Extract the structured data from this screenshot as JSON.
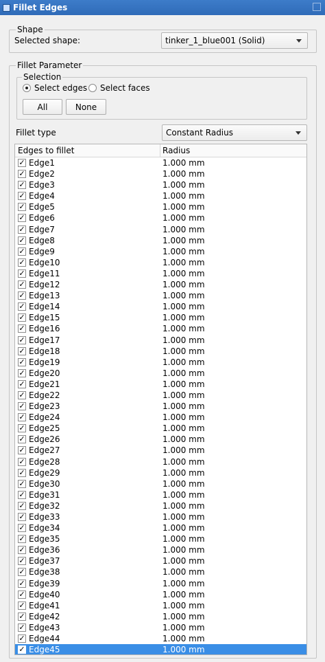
{
  "window": {
    "title": "Fillet Edges"
  },
  "shape_group": {
    "title": "Shape",
    "selected_label": "Selected shape:",
    "selected_value": "tinker_1_blue001 (Solid)"
  },
  "param_group": {
    "title": "Fillet Parameter",
    "selection": {
      "title": "Selection",
      "select_edges": "Select edges",
      "select_faces": "Select faces",
      "all_button": "All",
      "none_button": "None"
    },
    "fillet_type_label": "Fillet type",
    "fillet_type_value": "Constant Radius"
  },
  "table": {
    "headers": [
      "Edges to fillet",
      "Radius"
    ],
    "rows": [
      {
        "name": "Edge1",
        "radius": "1.000 mm"
      },
      {
        "name": "Edge2",
        "radius": "1.000 mm"
      },
      {
        "name": "Edge3",
        "radius": "1.000 mm"
      },
      {
        "name": "Edge4",
        "radius": "1.000 mm"
      },
      {
        "name": "Edge5",
        "radius": "1.000 mm"
      },
      {
        "name": "Edge6",
        "radius": "1.000 mm"
      },
      {
        "name": "Edge7",
        "radius": "1.000 mm"
      },
      {
        "name": "Edge8",
        "radius": "1.000 mm"
      },
      {
        "name": "Edge9",
        "radius": "1.000 mm"
      },
      {
        "name": "Edge10",
        "radius": "1.000 mm"
      },
      {
        "name": "Edge11",
        "radius": "1.000 mm"
      },
      {
        "name": "Edge12",
        "radius": "1.000 mm"
      },
      {
        "name": "Edge13",
        "radius": "1.000 mm"
      },
      {
        "name": "Edge14",
        "radius": "1.000 mm"
      },
      {
        "name": "Edge15",
        "radius": "1.000 mm"
      },
      {
        "name": "Edge16",
        "radius": "1.000 mm"
      },
      {
        "name": "Edge17",
        "radius": "1.000 mm"
      },
      {
        "name": "Edge18",
        "radius": "1.000 mm"
      },
      {
        "name": "Edge19",
        "radius": "1.000 mm"
      },
      {
        "name": "Edge20",
        "radius": "1.000 mm"
      },
      {
        "name": "Edge21",
        "radius": "1.000 mm"
      },
      {
        "name": "Edge22",
        "radius": "1.000 mm"
      },
      {
        "name": "Edge23",
        "radius": "1.000 mm"
      },
      {
        "name": "Edge24",
        "radius": "1.000 mm"
      },
      {
        "name": "Edge25",
        "radius": "1.000 mm"
      },
      {
        "name": "Edge26",
        "radius": "1.000 mm"
      },
      {
        "name": "Edge27",
        "radius": "1.000 mm"
      },
      {
        "name": "Edge28",
        "radius": "1.000 mm"
      },
      {
        "name": "Edge29",
        "radius": "1.000 mm"
      },
      {
        "name": "Edge30",
        "radius": "1.000 mm"
      },
      {
        "name": "Edge31",
        "radius": "1.000 mm"
      },
      {
        "name": "Edge32",
        "radius": "1.000 mm"
      },
      {
        "name": "Edge33",
        "radius": "1.000 mm"
      },
      {
        "name": "Edge34",
        "radius": "1.000 mm"
      },
      {
        "name": "Edge35",
        "radius": "1.000 mm"
      },
      {
        "name": "Edge36",
        "radius": "1.000 mm"
      },
      {
        "name": "Edge37",
        "radius": "1.000 mm"
      },
      {
        "name": "Edge38",
        "radius": "1.000 mm"
      },
      {
        "name": "Edge39",
        "radius": "1.000 mm"
      },
      {
        "name": "Edge40",
        "radius": "1.000 mm"
      },
      {
        "name": "Edge41",
        "radius": "1.000 mm"
      },
      {
        "name": "Edge42",
        "radius": "1.000 mm"
      },
      {
        "name": "Edge43",
        "radius": "1.000 mm"
      },
      {
        "name": "Edge44",
        "radius": "1.000 mm"
      },
      {
        "name": "Edge45",
        "radius": "1.000 mm",
        "selected": true
      }
    ]
  }
}
